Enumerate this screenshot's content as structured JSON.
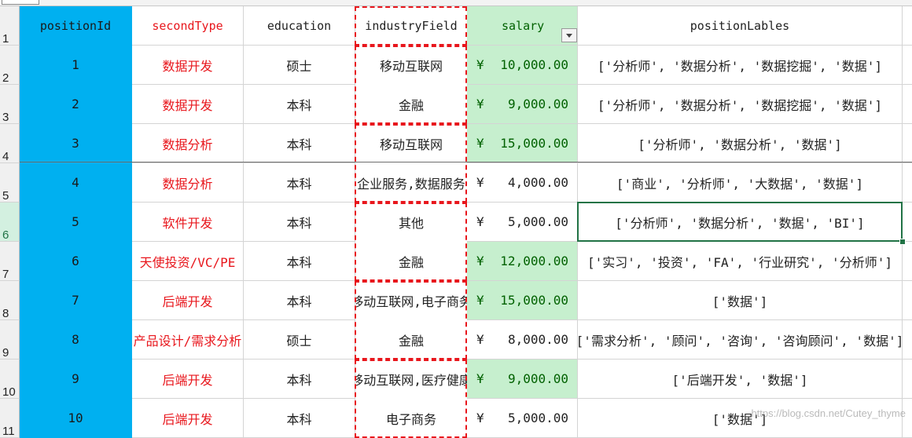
{
  "headers": {
    "row_number": "1",
    "positionId": "positionId",
    "secondType": "secondType",
    "education": "education",
    "industryField": "industryField",
    "salary": "salary",
    "positionLables": "positionLables"
  },
  "rows": [
    {
      "num": "2",
      "positionId": "1",
      "secondType": "数据开发",
      "education": "硕士",
      "industryField": "移动互联网",
      "currency": "¥",
      "salary": "10,000.00",
      "positionLables": "['分析师', '数据分析', '数据挖掘', '数据']"
    },
    {
      "num": "3",
      "positionId": "2",
      "secondType": "数据开发",
      "education": "本科",
      "industryField": "金融",
      "currency": "¥",
      "salary": "9,000.00",
      "positionLables": "['分析师', '数据分析', '数据挖掘', '数据']"
    },
    {
      "num": "4",
      "positionId": "3",
      "secondType": "数据分析",
      "education": "本科",
      "industryField": "移动互联网",
      "currency": "¥",
      "salary": "15,000.00",
      "positionLables": "['分析师', '数据分析', '数据']"
    },
    {
      "num": "5",
      "positionId": "4",
      "secondType": "数据分析",
      "education": "本科",
      "industryField": "企业服务,数据服务",
      "currency": "¥",
      "salary": "4,000.00",
      "positionLables": "['商业', '分析师', '大数据', '数据']"
    },
    {
      "num": "6",
      "positionId": "5",
      "secondType": "软件开发",
      "education": "本科",
      "industryField": "其他",
      "currency": "¥",
      "salary": "5,000.00",
      "positionLables": "['分析师', '数据分析', '数据', 'BI']"
    },
    {
      "num": "7",
      "positionId": "6",
      "secondType": "天使投资/VC/PE",
      "education": "本科",
      "industryField": "金融",
      "currency": "¥",
      "salary": "12,000.00",
      "positionLables": "['实习', '投资', 'FA', '行业研究', '分析师']"
    },
    {
      "num": "8",
      "positionId": "7",
      "secondType": "后端开发",
      "education": "本科",
      "industryField": "移动互联网,电子商务",
      "currency": "¥",
      "salary": "15,000.00",
      "positionLables": "['数据']"
    },
    {
      "num": "9",
      "positionId": "8",
      "secondType": "产品设计/需求分析",
      "education": "硕士",
      "industryField": "金融",
      "currency": "¥",
      "salary": "8,000.00",
      "positionLables": "['需求分析', '顾问', '咨询', '咨询顾问', '数据']"
    },
    {
      "num": "10",
      "positionId": "9",
      "secondType": "后端开发",
      "education": "本科",
      "industryField": "移动互联网,医疗健康",
      "currency": "¥",
      "salary": "9,000.00",
      "positionLables": "['后端开发', '数据']"
    },
    {
      "num": "11",
      "positionId": "10",
      "secondType": "后端开发",
      "education": "本科",
      "industryField": "电子商务",
      "currency": "¥",
      "salary": "5,000.00",
      "positionLables": "['数据']"
    }
  ],
  "highlight": {
    "salary_highlight_bg": "#c6efce",
    "salary_highlight_fg": "#006100",
    "id_fill": "#00b0f0",
    "type_font": "#e8161c",
    "selection": "#217346"
  },
  "selected_row": "6",
  "watermark": "https://blog.csdn.net/Cutey_thyme",
  "icons": {
    "filter": "filter-dropdown-icon"
  }
}
